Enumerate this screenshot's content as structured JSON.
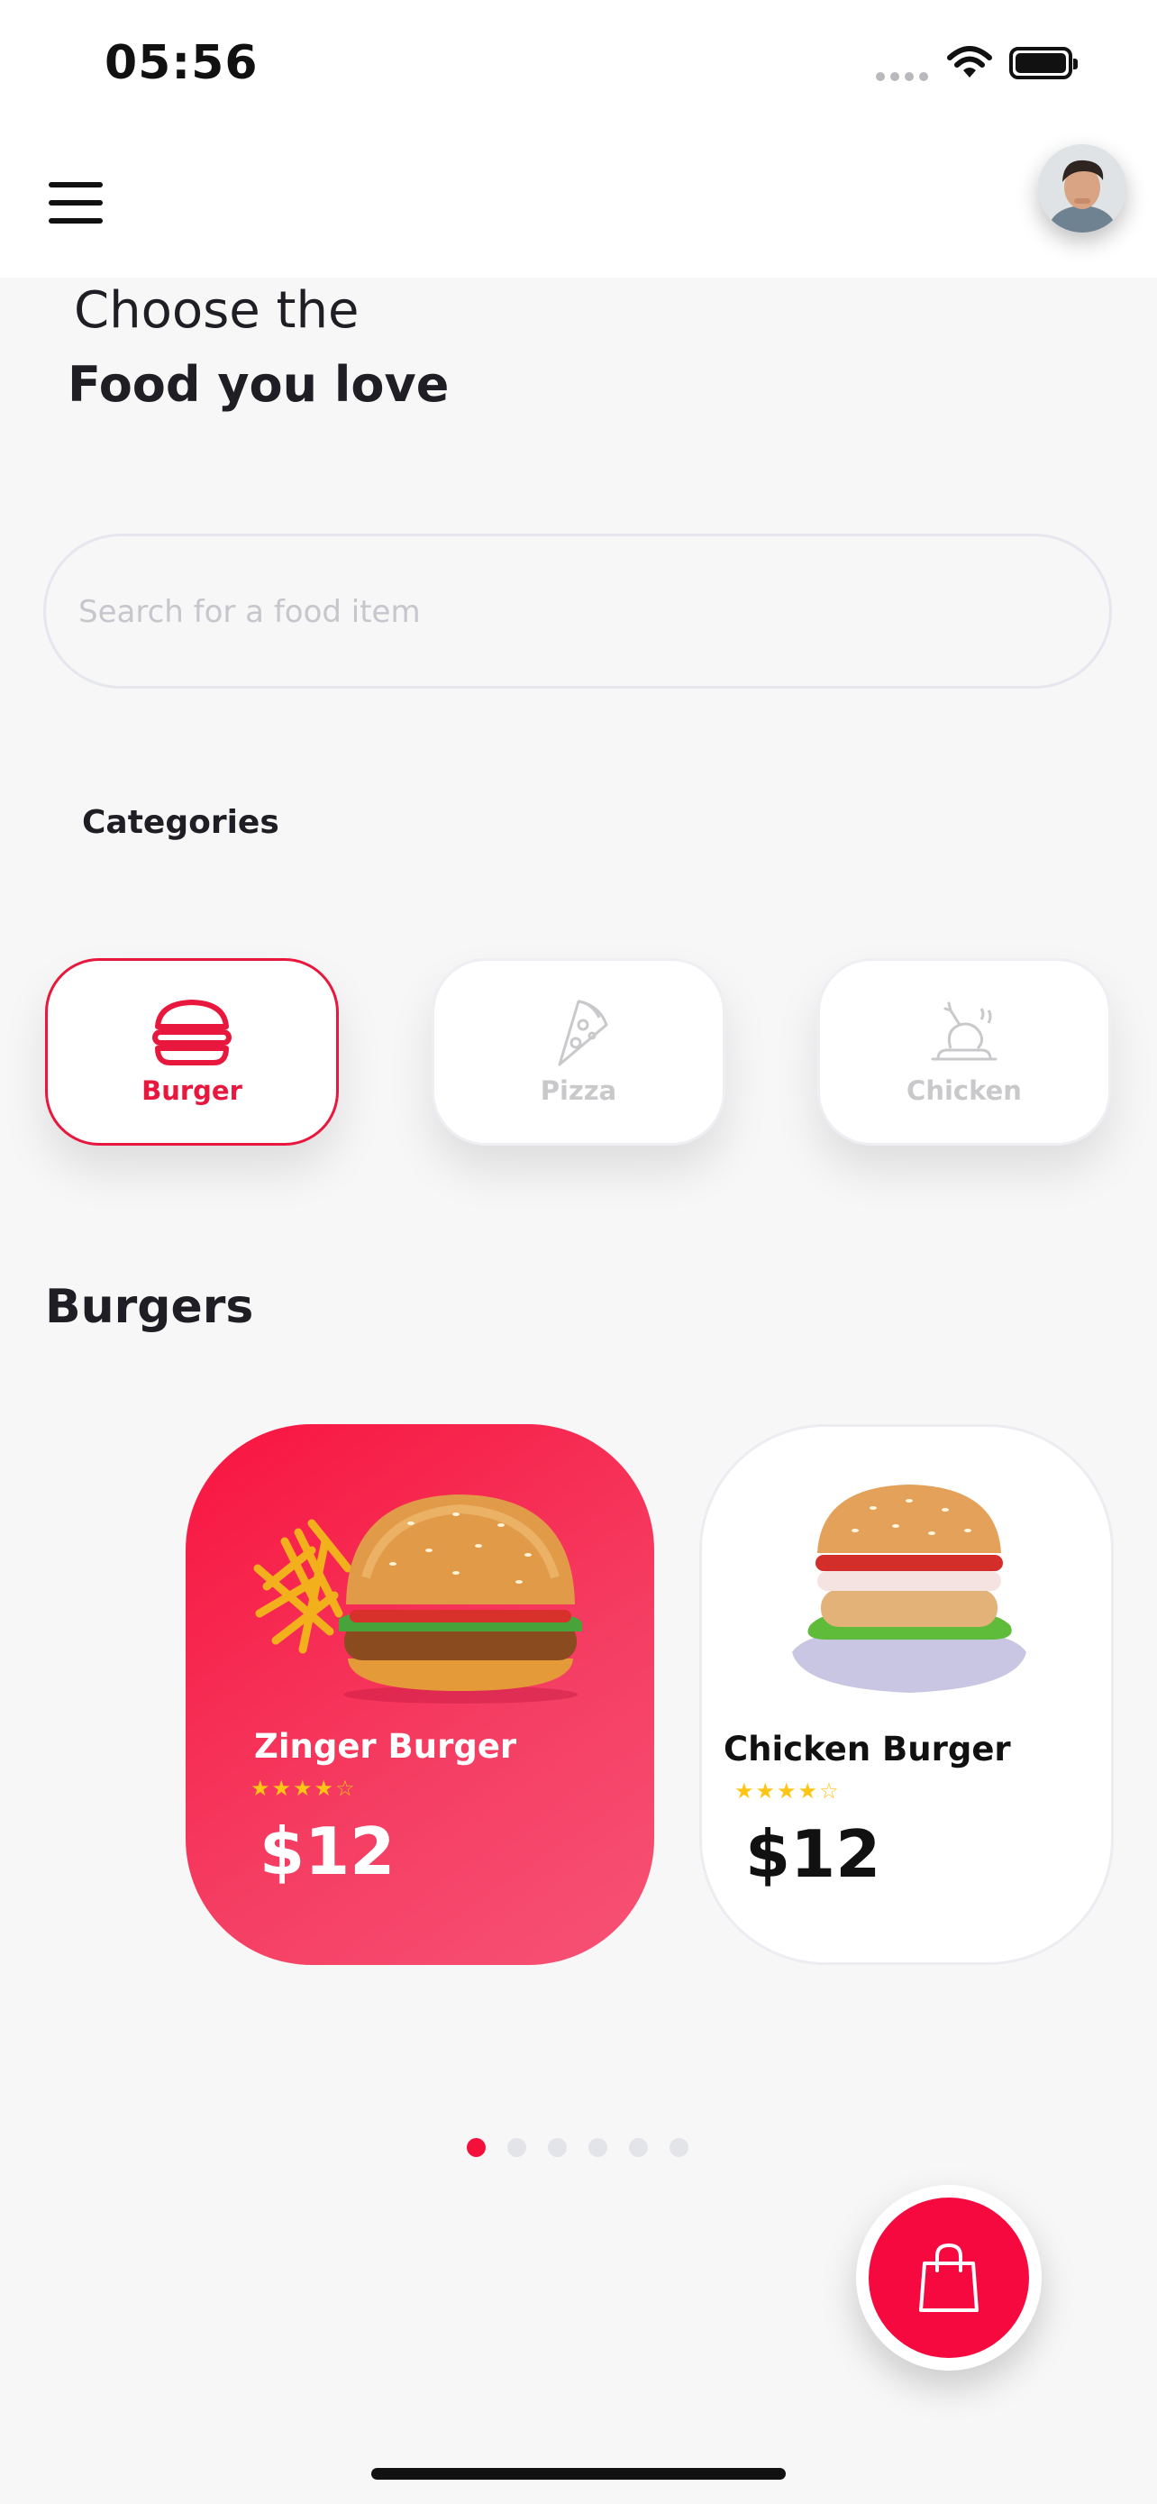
{
  "status_bar": {
    "time": "05:56"
  },
  "header": {
    "greeting_line1": "Choose the",
    "greeting_line2": "Food you love"
  },
  "search": {
    "placeholder": "Search for a food item"
  },
  "categories": {
    "title": "Categories",
    "items": [
      {
        "label": "Burger",
        "icon": "burger-icon",
        "active": true
      },
      {
        "label": "Pizza",
        "icon": "pizza-icon",
        "active": false
      },
      {
        "label": "Chicken",
        "icon": "chicken-icon",
        "active": false
      }
    ]
  },
  "section": {
    "title": "Burgers"
  },
  "products": [
    {
      "name": "Zinger Burger",
      "price": "$12",
      "rating": 4,
      "max_rating": 5
    },
    {
      "name": "Chicken Burger",
      "price": "$12",
      "rating": 4,
      "max_rating": 5
    }
  ],
  "pagination": {
    "count": 6,
    "active_index": 0
  },
  "colors": {
    "accent": "#f3113c",
    "star": "#ffc515",
    "background": "#f7f7f8"
  },
  "fab": {
    "icon": "shopping-bag-icon"
  }
}
